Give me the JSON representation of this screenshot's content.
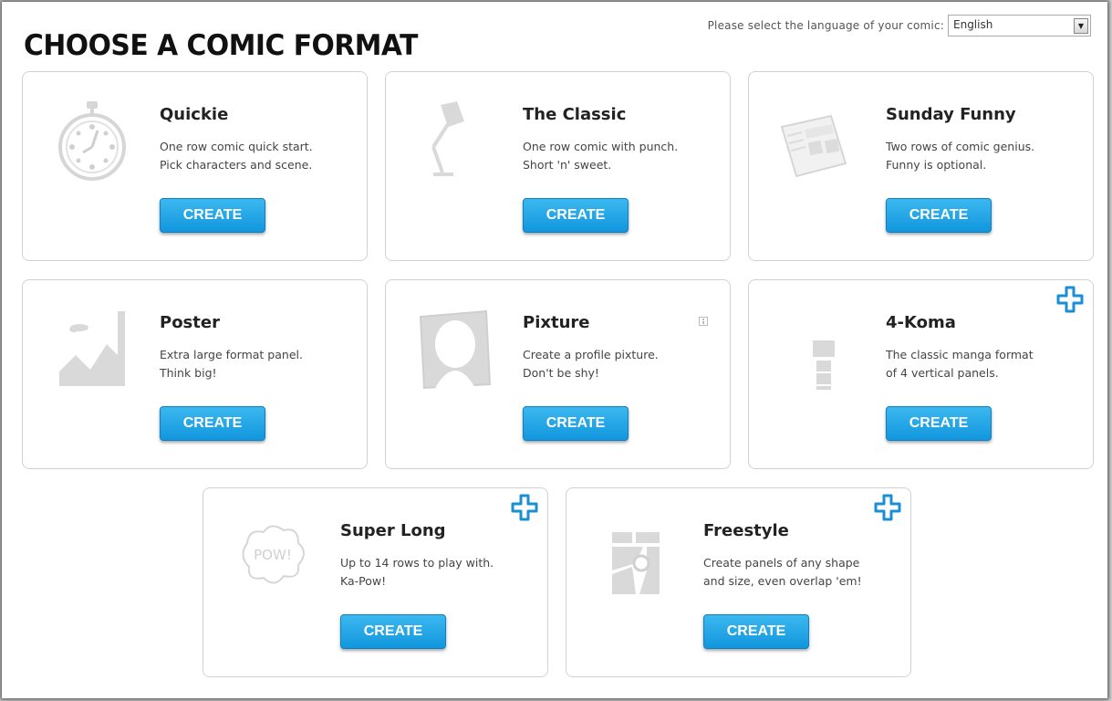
{
  "page": {
    "title": "CHOOSE A COMIC FORMAT"
  },
  "language": {
    "label": "Please select the language of your comic:",
    "selected": "English"
  },
  "colors": {
    "button_top": "#3cb8f0",
    "button_bottom": "#1196dd",
    "plus_icon": "#1a8fd6",
    "icon_gray": "#d9d9d9"
  },
  "formats": [
    {
      "title": "Quickie",
      "desc1": "One row comic quick start.",
      "desc2": "Pick characters and scene.",
      "button": "CREATE",
      "icon": "stopwatch-icon"
    },
    {
      "title": "The Classic",
      "desc1": "One row comic with punch.",
      "desc2": "Short 'n' sweet.",
      "button": "CREATE",
      "icon": "desk-lamp-icon"
    },
    {
      "title": "Sunday Funny",
      "desc1": "Two rows of comic genius.",
      "desc2": "Funny is optional.",
      "button": "CREATE",
      "icon": "newspaper-icon"
    },
    {
      "title": "Poster",
      "desc1": "Extra large format panel.",
      "desc2": "Think big!",
      "button": "CREATE",
      "icon": "landscape-icon"
    },
    {
      "title": "Pixture",
      "desc1": "Create a profile pixture.",
      "desc2": "Don't be shy!",
      "button": "CREATE",
      "icon": "profile-photo-icon"
    },
    {
      "title": "4-Koma",
      "desc1": "The classic manga format",
      "desc2": "of 4 vertical panels.",
      "button": "CREATE",
      "icon": "vertical-panels-icon"
    },
    {
      "title": "Super Long",
      "desc1": "Up to 14 rows to play with.",
      "desc2": "Ka-Pow!",
      "button": "CREATE",
      "icon": "pow-cloud-icon",
      "pow_text": "POW!"
    },
    {
      "title": "Freestyle",
      "desc1": "Create panels of any shape",
      "desc2": "and size, even overlap 'em!",
      "button": "CREATE",
      "icon": "freestyle-map-icon"
    }
  ]
}
